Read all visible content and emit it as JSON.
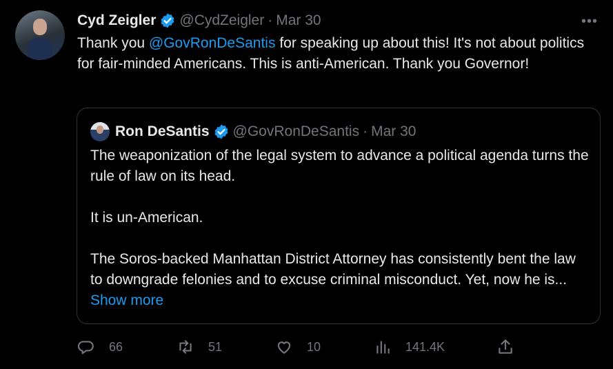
{
  "tweet": {
    "author_name": "Cyd Zeigler",
    "author_handle": "@CydZeigler",
    "separator": "·",
    "date": "Mar 30",
    "more_label": "•••",
    "text_before": "Thank you ",
    "mention": "@GovRonDeSantis",
    "text_after": " for speaking up about this! It's not about politics for fair-minded Americans. This is anti-American. Thank you Governor!"
  },
  "quote": {
    "author_name": "Ron DeSantis",
    "author_handle": "@GovRonDeSantis",
    "separator": "·",
    "date": "Mar 30",
    "para1": "The weaponization of the legal system to advance a political agenda turns the rule of law on its head.",
    "para2": "It is un-American.",
    "para3": "The Soros-backed Manhattan District Attorney has consistently bent the law to downgrade felonies and to excuse criminal misconduct. Yet, now he is...",
    "show_more": "Show more"
  },
  "actions": {
    "replies": "66",
    "retweets": "51",
    "likes": "10",
    "views": "141.4K"
  },
  "colors": {
    "accent": "#1d9bf0",
    "muted": "#71767b",
    "background": "#000000"
  }
}
